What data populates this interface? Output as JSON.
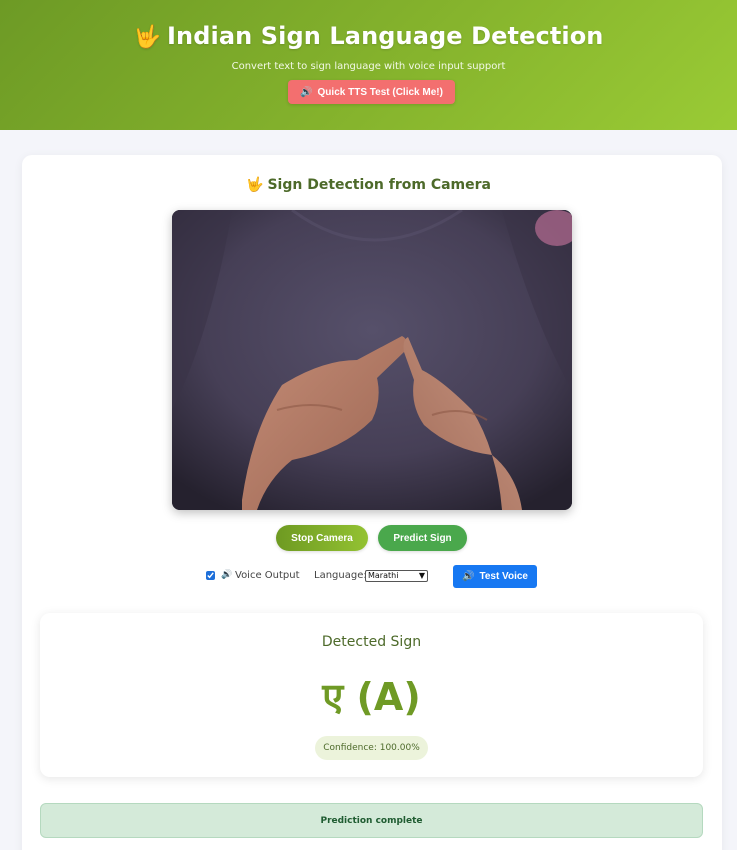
{
  "header": {
    "emoji": "🤟",
    "title": "Indian Sign Language Detection",
    "subtitle": "Convert text to sign language with voice input support",
    "tts_button": {
      "icon": "🔊",
      "label": "Quick TTS Test (Click Me!)"
    }
  },
  "camera_section": {
    "emoji": "🤟",
    "title": "Sign Detection from Camera",
    "stop_button": "Stop Camera",
    "predict_button": "Predict Sign"
  },
  "controls": {
    "voice_output_checked": true,
    "voice_icon": "🔊",
    "voice_output_label": "Voice Output",
    "language_label": "Language:",
    "language_selected": "Marathi",
    "test_voice": {
      "icon": "🔊",
      "label": "Test Voice"
    }
  },
  "result": {
    "heading": "Detected Sign",
    "value": "ए (A)",
    "confidence": "Confidence: 100.00%"
  },
  "status": "Prediction complete",
  "colors": {
    "header_green": "#86b42d",
    "accent_red": "#f36f6f",
    "accent_blue": "#1778f2",
    "success_bg": "#d4ead9"
  }
}
